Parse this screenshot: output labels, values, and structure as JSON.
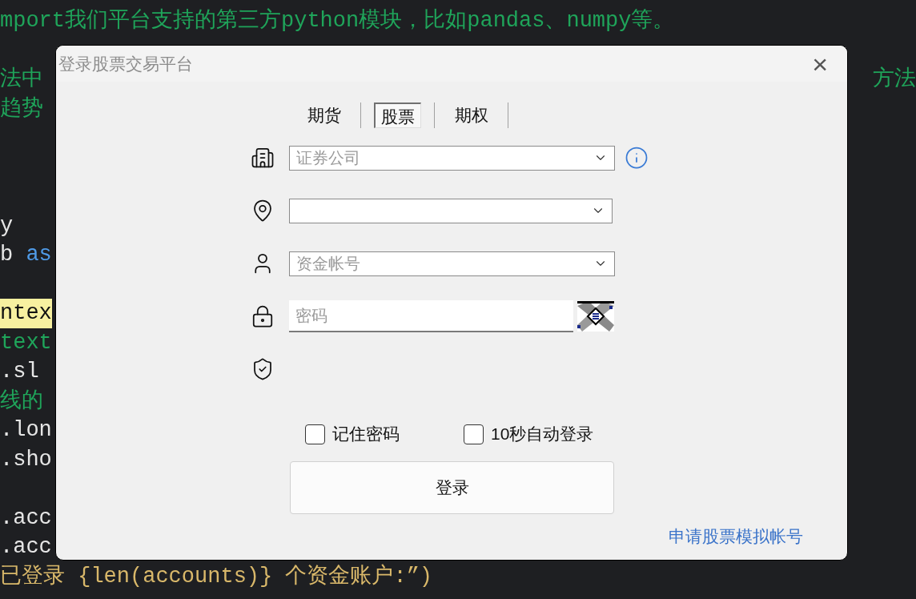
{
  "editor": {
    "lines": [
      {
        "kind": "code",
        "left": [
          {
            "text": "mport我们平台支持的第三方python模块，比如pandas、numpy等。",
            "kind": "comment"
          }
        ]
      },
      {
        "kind": "blank"
      },
      {
        "kind": "code",
        "left": [
          {
            "text": "法中",
            "kind": "comment"
          }
        ],
        "right": [
          {
            "text": "方法",
            "kind": "comment"
          }
        ]
      },
      {
        "kind": "code",
        "left": [
          {
            "text": "趋势",
            "kind": "comment"
          }
        ]
      },
      {
        "kind": "blank"
      },
      {
        "kind": "blank"
      },
      {
        "kind": "blank"
      },
      {
        "kind": "code",
        "left": [
          {
            "text": "y",
            "kind": "plain"
          }
        ]
      },
      {
        "kind": "code",
        "left": [
          {
            "text": "b ",
            "kind": "plain"
          },
          {
            "text": "as",
            "kind": "keyword"
          }
        ]
      },
      {
        "kind": "blank"
      },
      {
        "kind": "code",
        "left": [
          {
            "text": "ntex",
            "kind": "highlight"
          }
        ]
      },
      {
        "kind": "code",
        "left": [
          {
            "text": "text",
            "kind": "comment"
          }
        ]
      },
      {
        "kind": "code",
        "left": [
          {
            "text": ".sl",
            "kind": "plain"
          }
        ]
      },
      {
        "kind": "code",
        "left": [
          {
            "text": "线的",
            "kind": "comment"
          }
        ]
      },
      {
        "kind": "code",
        "left": [
          {
            "text": ".lon",
            "kind": "plain"
          }
        ]
      },
      {
        "kind": "code",
        "left": [
          {
            "text": ".sho",
            "kind": "plain"
          }
        ]
      },
      {
        "kind": "blank"
      },
      {
        "kind": "code",
        "left": [
          {
            "text": ".acc",
            "kind": "plain"
          }
        ]
      },
      {
        "kind": "code",
        "left": [
          {
            "text": ".acc",
            "kind": "plain"
          }
        ]
      },
      {
        "kind": "code",
        "left": [
          {
            "text": "已登录 {len(accounts)} 个资金账户:”)",
            "kind": "string"
          }
        ]
      }
    ]
  },
  "dialog": {
    "title": "登录股票交易平台",
    "close": "×",
    "tabs": [
      {
        "label": "期货",
        "selected": false
      },
      {
        "label": "股票",
        "selected": true
      },
      {
        "label": "期权",
        "selected": false
      }
    ],
    "fields": [
      {
        "kind": "select",
        "placeholder": "证券公司",
        "info": true
      },
      {
        "kind": "select"
      },
      {
        "kind": "select",
        "placeholder": "资金帐号"
      },
      {
        "kind": "password",
        "placeholder": "密码"
      },
      {
        "kind": "verify"
      }
    ],
    "options": [
      {
        "label": "记住密码",
        "checked": false
      },
      {
        "label": "10秒自动登录",
        "checked": false
      }
    ],
    "login_button": "登录",
    "link": "申请股票模拟帐号"
  }
}
